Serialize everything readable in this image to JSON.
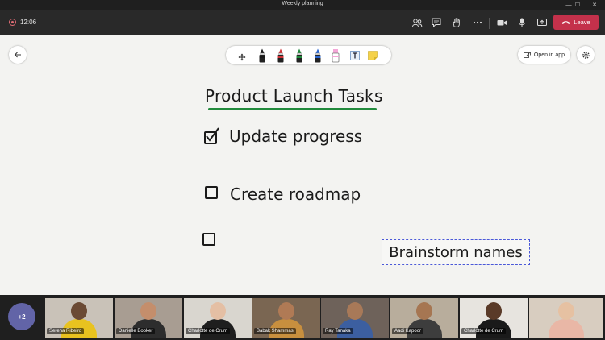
{
  "window": {
    "title": "Weekly planning",
    "controls": {
      "minimize": "—",
      "maximize": "☐",
      "close": "✕"
    }
  },
  "toolbar": {
    "timer": "12:06",
    "icons": [
      "people-icon",
      "chat-icon",
      "raise-hand-icon",
      "more-icon",
      "camera-icon",
      "mic-icon",
      "share-icon"
    ],
    "leave_label": "Leave",
    "accent_color": "#c4314b"
  },
  "whiteboard": {
    "open_in_app_label": "Open in app",
    "title": "Product Launch Tasks",
    "underline_color": "#218a3c",
    "pens": [
      {
        "name": "pen-black",
        "color": "#1a1a1a"
      },
      {
        "name": "pen-red",
        "color": "#d13438"
      },
      {
        "name": "pen-green",
        "color": "#218a3c"
      },
      {
        "name": "pen-blue",
        "color": "#2b67d1"
      },
      {
        "name": "highlighter-pink",
        "color": "#f4a6d7"
      }
    ],
    "tasks": [
      {
        "text": "Update progress",
        "checked": true
      },
      {
        "text": "Create roadmap",
        "checked": false
      },
      {
        "text": "",
        "checked": false
      }
    ],
    "note_text": "Brainstorm names",
    "note_border_color": "#4a58d8"
  },
  "participants": {
    "more_label": "+2",
    "tiles": [
      {
        "name": "Serena Ribeiro",
        "bg": "#c9c2b8",
        "skin": "#6b4a34",
        "shirt": "#e8c21f"
      },
      {
        "name": "Danielle Booker",
        "bg": "#a89d92",
        "skin": "#c48e6c",
        "shirt": "#2d2d2d"
      },
      {
        "name": "Charlotte de Crum",
        "bg": "#d9d6cf",
        "skin": "#e4bfa4",
        "shirt": "#1e1e1e"
      },
      {
        "name": "Babak Shammas",
        "bg": "#7a6652",
        "skin": "#b07a55",
        "shirt": "#c88f3e"
      },
      {
        "name": "Ray Tanaka",
        "bg": "#6e625a",
        "skin": "#a87958",
        "shirt": "#3c5fa0"
      },
      {
        "name": "Aadi Kapoor",
        "bg": "#b8ad9c",
        "skin": "#a67652",
        "shirt": "#3d3d3d"
      },
      {
        "name": "Charlotte de Crum",
        "bg": "#e7e4df",
        "skin": "#5a3a28",
        "shirt": "#1a1a1a"
      },
      {
        "name": "",
        "bg": "#d8cdc0",
        "skin": "#e6c1a2",
        "shirt": "#e9b7a6"
      }
    ]
  }
}
